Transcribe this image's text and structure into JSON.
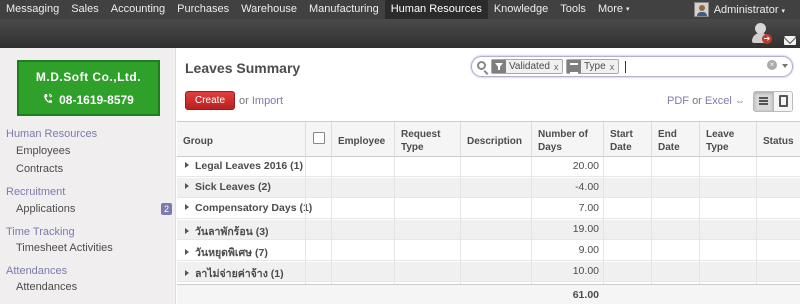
{
  "topnav": {
    "items": [
      {
        "label": "Messaging"
      },
      {
        "label": "Sales"
      },
      {
        "label": "Accounting"
      },
      {
        "label": "Purchases"
      },
      {
        "label": "Warehouse"
      },
      {
        "label": "Manufacturing"
      },
      {
        "label": "Human Resources",
        "active": true
      },
      {
        "label": "Knowledge"
      },
      {
        "label": "Tools"
      },
      {
        "label": "More"
      }
    ],
    "user": "Administrator",
    "more_caret": "▾",
    "user_caret": "▾"
  },
  "logo": {
    "line1": "M.D.Soft Co.,Ltd.",
    "line2": "08-1619-8579",
    "phone_icon": "phone-icon"
  },
  "sidebar": {
    "sections": [
      {
        "title": "Human Resources",
        "items": [
          {
            "label": "Employees"
          },
          {
            "label": "Contracts"
          }
        ]
      },
      {
        "title": "Recruitment",
        "items": [
          {
            "label": "Applications",
            "badge": "2"
          }
        ]
      },
      {
        "title": "Time Tracking",
        "items": [
          {
            "label": "Timesheet Activities"
          }
        ]
      },
      {
        "title": "Attendances",
        "items": [
          {
            "label": "Attendances"
          }
        ]
      }
    ]
  },
  "main": {
    "title": "Leaves Summary",
    "search": {
      "facets": [
        {
          "kind": "filter",
          "label": "Validated",
          "remove": "x"
        },
        {
          "kind": "group",
          "label": "Type",
          "remove": "x"
        }
      ],
      "clear": "×"
    },
    "create_label": "Create",
    "or_label": "or",
    "import_label": "Import",
    "export": {
      "pdf": "PDF",
      "or": "or",
      "excel": "Excel",
      "arrow": "⇔"
    },
    "columns": [
      "Group",
      "",
      "Employee",
      "Request Type",
      "Description",
      "Number of Days",
      "Start Date",
      "End Date",
      "Leave Type",
      "Status"
    ],
    "groups": [
      {
        "label": "Legal Leaves 2016 (1)",
        "days": "20.00"
      },
      {
        "label": "Sick Leaves (2)",
        "days": "-4.00"
      },
      {
        "label": "Compensatory Days (1)",
        "days": "7.00"
      },
      {
        "label": "วันลาพักร้อน (3)",
        "days": "19.00"
      },
      {
        "label": "วันหยุดพิเศษ (7)",
        "days": "9.00"
      },
      {
        "label": "ลาไม่จ่ายค่าจ้าง (1)",
        "days": "10.00"
      }
    ],
    "total_days": "61.00"
  },
  "colors": {
    "accent": "#7c7bad",
    "create_button": "#d13232",
    "logo_bg": "#2fa02a",
    "topbar": "#414141"
  }
}
